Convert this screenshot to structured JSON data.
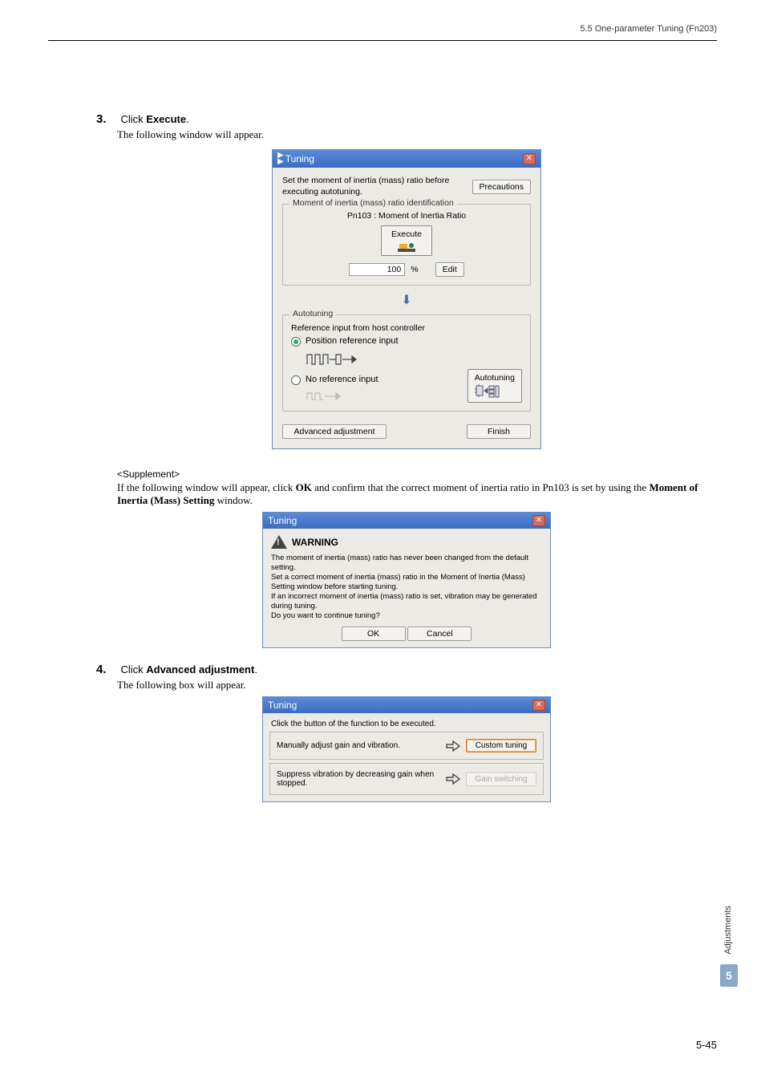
{
  "header": {
    "section": "5.5  One-parameter Tuning (Fn203)"
  },
  "step3": {
    "num": "3.",
    "action_prefix": "Click ",
    "action_bold": "Execute",
    "action_suffix": ".",
    "desc": "The following window will appear."
  },
  "dlg1": {
    "title": "Tuning",
    "msg": "Set the moment of inertia (mass) ratio before executing autotuning.",
    "precautions": "Precautions",
    "fieldset1_legend": "Moment of inertia (mass) ratio identification",
    "pn_label": "Pn103 : Moment of Inertia Ratio",
    "execute": "Execute",
    "value": "100",
    "pct": "%",
    "edit": "Edit",
    "fieldset2_legend": "Autotuning",
    "ref_label": "Reference input from host controller",
    "radio1": "Position reference input",
    "radio2": "No reference input",
    "autotuning": "Autotuning",
    "advanced": "Advanced adjustment",
    "finish": "Finish"
  },
  "supp": {
    "hdr": "<Supplement>",
    "line_a": "If the following window will appear, click ",
    "line_bold1": "OK",
    "line_b": " and confirm that the correct moment of inertia ratio in Pn103 is set by using the ",
    "line_bold2": "Moment of Inertia (Mass) Setting",
    "line_c": " window."
  },
  "dlg2": {
    "title": "Tuning",
    "warn": "WARNING",
    "body1": "The moment of inertia (mass) ratio has never been changed from the default setting.",
    "body2": "Set a correct moment of inertia (mass) ratio in the Moment of Inertia (Mass) Setting window before starting tuning.",
    "body3": "If an incorrect moment of inertia (mass) ratio is set, vibration may be generated during tuning.",
    "body4": "Do you want to continue tuning?",
    "ok": "OK",
    "cancel": "Cancel"
  },
  "step4": {
    "num": "4.",
    "action_prefix": "Click ",
    "action_bold": "Advanced adjustment",
    "action_suffix": ".",
    "desc": "The following box will appear."
  },
  "dlg3": {
    "title": "Tuning",
    "hdr": "Click the button of the function to be executed.",
    "row1": "Manually adjust gain and vibration.",
    "btn1": "Custom tuning",
    "row2": "Suppress vibration by decreasing gain when stopped.",
    "btn2": "Gain switching"
  },
  "side": {
    "tab": "Adjustments",
    "num": "5"
  },
  "pagenum": "5-45"
}
